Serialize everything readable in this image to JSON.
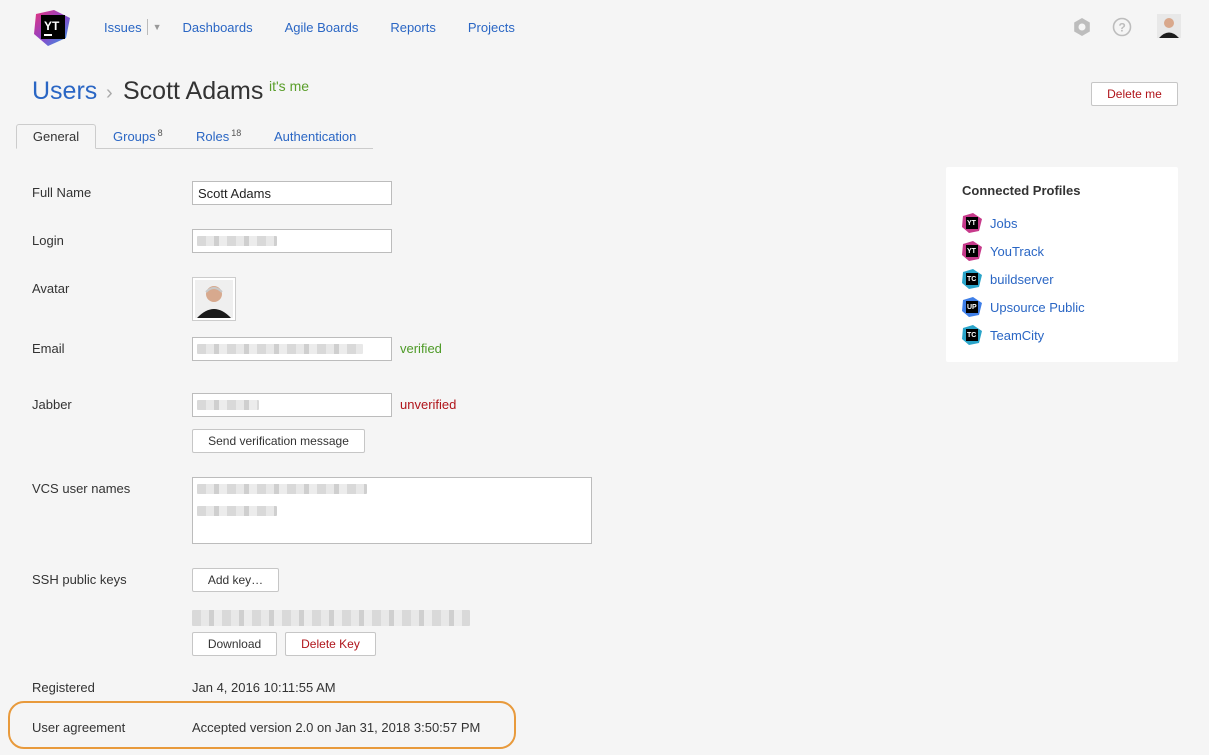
{
  "nav": {
    "logo_text": "YT",
    "items": [
      "Issues",
      "Dashboards",
      "Agile Boards",
      "Reports",
      "Projects"
    ]
  },
  "page": {
    "breadcrumb_root": "Users",
    "breadcrumb_sep": "›",
    "title": "Scott Adams",
    "badge": "it's me",
    "delete_me": "Delete me"
  },
  "tabs": [
    {
      "label": "General",
      "count": ""
    },
    {
      "label": "Groups",
      "count": "8"
    },
    {
      "label": "Roles",
      "count": "18"
    },
    {
      "label": "Authentication",
      "count": ""
    }
  ],
  "form": {
    "full_name_label": "Full Name",
    "full_name_value": "Scott Adams",
    "login_label": "Login",
    "avatar_label": "Avatar",
    "email_label": "Email",
    "email_status": "verified",
    "jabber_label": "Jabber",
    "jabber_status": "unverified",
    "send_verification": "Send verification message",
    "vcs_label": "VCS user names",
    "ssh_label": "SSH public keys",
    "add_key": "Add key…",
    "download": "Download",
    "delete_key": "Delete Key",
    "registered_label": "Registered",
    "registered_value": "Jan 4, 2016 10:11:55 AM",
    "agreement_label": "User agreement",
    "agreement_value": "Accepted version 2.0 on Jan 31, 2018 3:50:57 PM"
  },
  "profiles": {
    "title": "Connected Profiles",
    "items": [
      {
        "name": "Jobs",
        "icon": "YT",
        "icon_name": "youtrack-icon"
      },
      {
        "name": "YouTrack",
        "icon": "YT",
        "icon_name": "youtrack-icon"
      },
      {
        "name": "buildserver",
        "icon": "TC",
        "icon_name": "teamcity-icon"
      },
      {
        "name": "Upsource Public",
        "icon": "UP",
        "icon_name": "upsource-icon"
      },
      {
        "name": "TeamCity",
        "icon": "TC",
        "icon_name": "teamcity-icon"
      }
    ]
  },
  "colors": {
    "link": "#2a66c4",
    "verified": "#4d9a26",
    "danger": "#b0141a",
    "highlight": "#e89a3c"
  }
}
